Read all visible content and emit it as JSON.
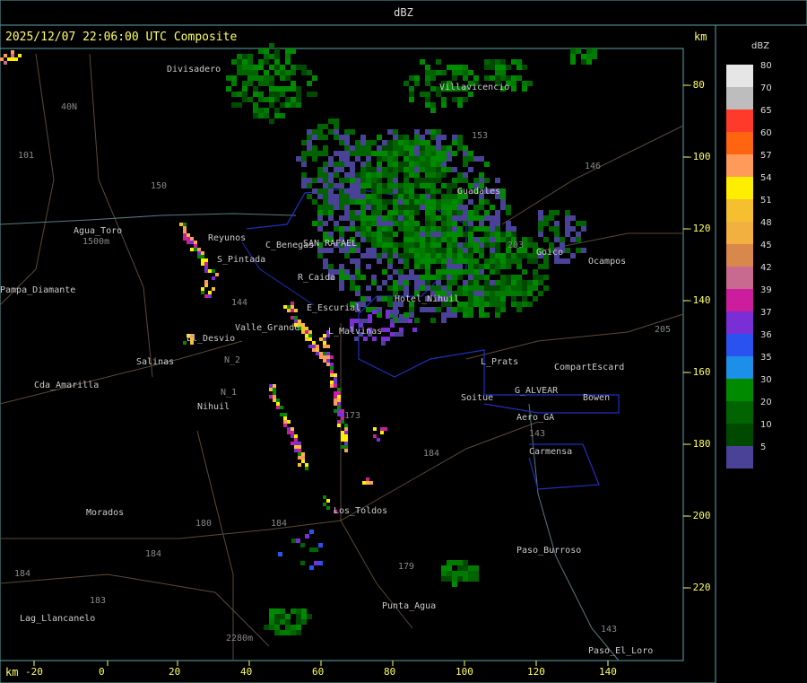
{
  "header": {
    "title": "dBZ"
  },
  "stamp": "2025/12/07 22:06:00 UTC Composite",
  "units": {
    "top": "km",
    "bottom": "km"
  },
  "legend": {
    "title": "dBZ",
    "items": [
      {
        "label": "80",
        "color": "#e6e6e6"
      },
      {
        "label": "70",
        "color": "#bdbdbd"
      },
      {
        "label": "65",
        "color": "#ff3a2a"
      },
      {
        "label": "60",
        "color": "#ff6410"
      },
      {
        "label": "57",
        "color": "#ff9a5a"
      },
      {
        "label": "54",
        "color": "#ffee00"
      },
      {
        "label": "51",
        "color": "#f5bf30"
      },
      {
        "label": "48",
        "color": "#f2b040"
      },
      {
        "label": "45",
        "color": "#d8884a"
      },
      {
        "label": "42",
        "color": "#c86a90"
      },
      {
        "label": "39",
        "color": "#cc1e9c"
      },
      {
        "label": "37",
        "color": "#7a2ed6"
      },
      {
        "label": "36",
        "color": "#2a52f0"
      },
      {
        "label": "35",
        "color": "#1c8fe8"
      },
      {
        "label": "30",
        "color": "#008a00"
      },
      {
        "label": "20",
        "color": "#006400"
      },
      {
        "label": "10",
        "color": "#004a00"
      },
      {
        "label": "5",
        "color": "#4a4296"
      }
    ]
  },
  "axes": {
    "x_ticks": [
      "-20",
      "0",
      "20",
      "40",
      "60",
      "80",
      "100",
      "120",
      "140"
    ],
    "y_ticks": [
      "-80",
      "-100",
      "-120",
      "-140",
      "-160",
      "-180",
      "-200",
      "-220"
    ]
  },
  "places": [
    {
      "name": "Divisadero",
      "x": 186,
      "y": 78
    },
    {
      "name": "Villavicencio",
      "x": 490,
      "y": 98
    },
    {
      "name": "Guadales",
      "x": 510,
      "y": 214
    },
    {
      "name": "Agua_Toro",
      "x": 82,
      "y": 258
    },
    {
      "name": "Reyunos",
      "x": 232,
      "y": 266
    },
    {
      "name": "C_Benegas",
      "x": 296,
      "y": 274
    },
    {
      "name": "S_Pintada",
      "x": 242,
      "y": 290
    },
    {
      "name": "SAN RAFAEL",
      "x": 338,
      "y": 272
    },
    {
      "name": "Goico",
      "x": 598,
      "y": 282
    },
    {
      "name": "Ocampos",
      "x": 656,
      "y": 292
    },
    {
      "name": "Pampa_Diamante",
      "x": 0,
      "y": 324
    },
    {
      "name": "R_Caida",
      "x": 332,
      "y": 310
    },
    {
      "name": "E_Escurial",
      "x": 342,
      "y": 344
    },
    {
      "name": "Hotel_Nihuil",
      "x": 440,
      "y": 334
    },
    {
      "name": "Valle_Grande",
      "x": 262,
      "y": 366
    },
    {
      "name": "L_Malvinas",
      "x": 366,
      "y": 370
    },
    {
      "name": "El_Desvio",
      "x": 208,
      "y": 378
    },
    {
      "name": "Salinas",
      "x": 152,
      "y": 404
    },
    {
      "name": "L_Prats",
      "x": 536,
      "y": 404
    },
    {
      "name": "CompartEscard",
      "x": 618,
      "y": 410
    },
    {
      "name": "Cda_Amarilla",
      "x": 38,
      "y": 430
    },
    {
      "name": "G_ALVEAR",
      "x": 574,
      "y": 436
    },
    {
      "name": "Soitue",
      "x": 514,
      "y": 444
    },
    {
      "name": "Bowen",
      "x": 650,
      "y": 444
    },
    {
      "name": "Nihuil",
      "x": 220,
      "y": 454
    },
    {
      "name": "Aero_GA",
      "x": 576,
      "y": 466
    },
    {
      "name": "Carmensa",
      "x": 590,
      "y": 504
    },
    {
      "name": "Morados",
      "x": 96,
      "y": 572
    },
    {
      "name": "Los_Toldos",
      "x": 372,
      "y": 570
    },
    {
      "name": "Paso_Burroso",
      "x": 576,
      "y": 614
    },
    {
      "name": "Punta_Agua",
      "x": 426,
      "y": 676
    },
    {
      "name": "Lag_Llancanelo",
      "x": 22,
      "y": 690
    },
    {
      "name": "Paso_El_Loro",
      "x": 656,
      "y": 726
    }
  ],
  "routes": [
    {
      "label": "40N",
      "x": 68,
      "y": 120
    },
    {
      "label": "101",
      "x": 20,
      "y": 174
    },
    {
      "label": "150",
      "x": 168,
      "y": 208
    },
    {
      "label": "153",
      "x": 526,
      "y": 152
    },
    {
      "label": "146",
      "x": 652,
      "y": 186
    },
    {
      "label": "203",
      "x": 566,
      "y": 274
    },
    {
      "label": "144",
      "x": 258,
      "y": 338
    },
    {
      "label": "205",
      "x": 730,
      "y": 368
    },
    {
      "label": "N_2",
      "x": 250,
      "y": 402
    },
    {
      "label": "N_1",
      "x": 246,
      "y": 438
    },
    {
      "label": "173",
      "x": 384,
      "y": 464
    },
    {
      "label": "184",
      "x": 472,
      "y": 506
    },
    {
      "label": "143",
      "x": 590,
      "y": 484
    },
    {
      "label": "184",
      "x": 302,
      "y": 584
    },
    {
      "label": "180",
      "x": 218,
      "y": 584
    },
    {
      "label": "184",
      "x": 162,
      "y": 618
    },
    {
      "label": "184",
      "x": 16,
      "y": 640
    },
    {
      "label": "179",
      "x": 444,
      "y": 632
    },
    {
      "label": "183",
      "x": 100,
      "y": 670
    },
    {
      "label": "143",
      "x": 670,
      "y": 702
    },
    {
      "label": "2280m",
      "x": 252,
      "y": 712
    },
    {
      "label": "1500m",
      "x": 92,
      "y": 270
    }
  ]
}
